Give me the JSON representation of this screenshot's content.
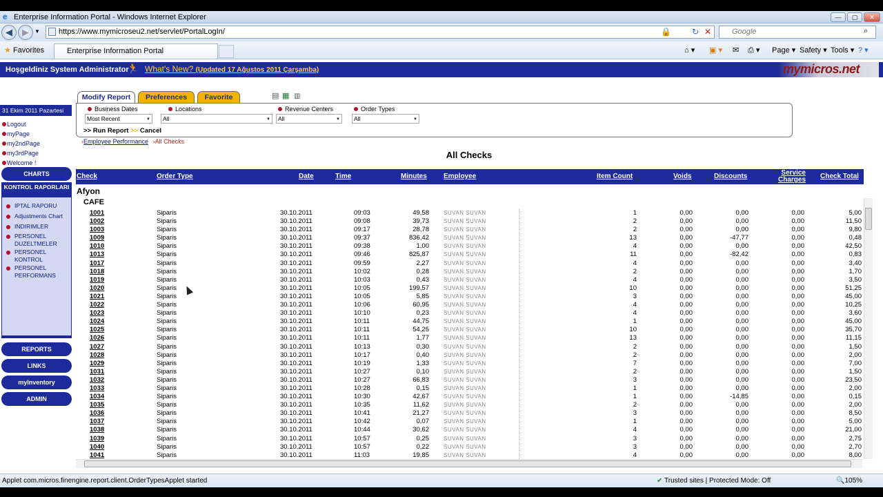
{
  "window": {
    "title": "Enterprise Information Portal - Windows Internet Explorer",
    "url": "https://www.mymicroseu2.net/servlet/PortalLogIn/",
    "search_placeholder": "Google",
    "favorites_label": "Favorites",
    "tab_title": "Enterprise Information Portal",
    "commands": {
      "page": "Page",
      "safety": "Safety",
      "tools": "Tools"
    }
  },
  "banner": {
    "welcome": "Hoşgeldiniz System Administrator",
    "whats_new": "What's New?",
    "whats_new_date": "(Updated 17 Ağustos 2011 Çarşamba)",
    "logo": "mymicros.net"
  },
  "sidebar": {
    "date": "31 Ekim 2011 Pazartesi",
    "links": [
      "Logout",
      "myPage",
      "my2ndPage",
      "my3rdPage",
      "Welcome !"
    ],
    "charts": "CHARTS",
    "kontrol_title": "KONTROL RAPORLARI",
    "kontrol_links": [
      "IPTAL RAPORU",
      "Adjustments Chart",
      "INDIRIMLER",
      "PERSONEL DUZELTMELER",
      "PERSONEL KONTROL",
      "PERSONEL PERFORMANS"
    ],
    "reports": "REPORTS",
    "links_btn": "LINKS",
    "myinventory": "myInventory",
    "admin": "ADMIN"
  },
  "tabs": {
    "modify": "Modify Report",
    "preferences": "Preferences",
    "favorite": "Favorite"
  },
  "filters": {
    "business_dates_label": "Business Dates",
    "business_dates_value": "Most Recent",
    "locations_label": "Locations",
    "locations_value": "All",
    "revenue_centers_label": "Revenue Centers",
    "revenue_centers_value": "All",
    "order_types_label": "Order Types",
    "order_types_value": "All",
    "run": ">> Run Report",
    "cancel": "Cancel"
  },
  "breadcrumbs": {
    "first": "Employee Performance",
    "second": "All Checks"
  },
  "report": {
    "title": "All Checks",
    "columns": {
      "check": "Check",
      "order_type": "Order Type",
      "date": "Date",
      "time": "Time",
      "minutes": "Minutes",
      "employee": "Employee",
      "item_count": "Item Count",
      "voids": "Voids",
      "discounts": "Discounts",
      "service_charges": "Service Charges",
      "check_total": "Check Total"
    },
    "group": "Afyon",
    "subgroup": "CAFE",
    "rows": [
      [
        "1001",
        "Siparis",
        "30.10.2011",
        "09:03",
        "49,58",
        "1",
        "0,00",
        "0,00",
        "0,00",
        "5,00"
      ],
      [
        "1002",
        "Siparis",
        "30.10.2011",
        "09:08",
        "39,73",
        "2",
        "0,00",
        "0,00",
        "0,00",
        "11,50"
      ],
      [
        "1003",
        "Siparis",
        "30.10.2011",
        "09:17",
        "28,78",
        "2",
        "0,00",
        "0,00",
        "0,00",
        "9,80"
      ],
      [
        "1009",
        "Siparis",
        "30.10.2011",
        "09:37",
        "836,42",
        "13",
        "0,00",
        "-47,77",
        "0,00",
        "0,48"
      ],
      [
        "1010",
        "Siparis",
        "30.10.2011",
        "09:38",
        "1,00",
        "4",
        "0,00",
        "0,00",
        "0,00",
        "42,50"
      ],
      [
        "1013",
        "Siparis",
        "30.10.2011",
        "09:46",
        "825,87",
        "11",
        "0,00",
        "-82,42",
        "0,00",
        "0,83"
      ],
      [
        "1017",
        "Siparis",
        "30.10.2011",
        "09:59",
        "2,27",
        "4",
        "0,00",
        "0,00",
        "0,00",
        "3,40"
      ],
      [
        "1018",
        "Siparis",
        "30.10.2011",
        "10:02",
        "0,28",
        "2",
        "0,00",
        "0,00",
        "0,00",
        "1,70"
      ],
      [
        "1019",
        "Siparis",
        "30.10.2011",
        "10:03",
        "0,43",
        "4",
        "0,00",
        "0,00",
        "0,00",
        "3,50"
      ],
      [
        "1020",
        "Siparis",
        "30.10.2011",
        "10:05",
        "199,57",
        "10",
        "0,00",
        "0,00",
        "0,00",
        "51,25"
      ],
      [
        "1021",
        "Siparis",
        "30.10.2011",
        "10:05",
        "5,85",
        "3",
        "0,00",
        "0,00",
        "0,00",
        "45,00"
      ],
      [
        "1022",
        "Siparis",
        "30.10.2011",
        "10:06",
        "60,95",
        "4",
        "0,00",
        "0,00",
        "0,00",
        "10,25"
      ],
      [
        "1023",
        "Siparis",
        "30.10.2011",
        "10:10",
        "0,23",
        "4",
        "0,00",
        "0,00",
        "0,00",
        "3,60"
      ],
      [
        "1024",
        "Siparis",
        "30.10.2011",
        "10:11",
        "44,75",
        "1",
        "0,00",
        "0,00",
        "0,00",
        "45,00"
      ],
      [
        "1025",
        "Siparis",
        "30.10.2011",
        "10:11",
        "54,25",
        "10",
        "0,00",
        "0,00",
        "0,00",
        "35,70"
      ],
      [
        "1026",
        "Siparis",
        "30.10.2011",
        "10:11",
        "1,77",
        "13",
        "0,00",
        "0,00",
        "0,00",
        "11,15"
      ],
      [
        "1027",
        "Siparis",
        "30.10.2011",
        "10:13",
        "0,30",
        "2",
        "0,00",
        "0,00",
        "0,00",
        "1,50"
      ],
      [
        "1028",
        "Siparis",
        "30.10.2011",
        "10:17",
        "0,40",
        "2",
        "0,00",
        "0,00",
        "0,00",
        "2,00"
      ],
      [
        "1029",
        "Siparis",
        "30.10.2011",
        "10:19",
        "1,33",
        "7",
        "0,00",
        "0,00",
        "0,00",
        "7,00"
      ],
      [
        "1031",
        "Siparis",
        "30.10.2011",
        "10:27",
        "0,10",
        "2",
        "0,00",
        "0,00",
        "0,00",
        "1,50"
      ],
      [
        "1032",
        "Siparis",
        "30.10.2011",
        "10:27",
        "66,83",
        "3",
        "0,00",
        "0,00",
        "0,00",
        "23,50"
      ],
      [
        "1033",
        "Siparis",
        "30.10.2011",
        "10:28",
        "0,15",
        "1",
        "0,00",
        "0,00",
        "0,00",
        "2,00"
      ],
      [
        "1034",
        "Siparis",
        "30.10.2011",
        "10:30",
        "42,67",
        "1",
        "0,00",
        "-14,85",
        "0,00",
        "0,15"
      ],
      [
        "1035",
        "Siparis",
        "30.10.2011",
        "10:35",
        "11,62",
        "2",
        "0,00",
        "0,00",
        "0,00",
        "2,00"
      ],
      [
        "1036",
        "Siparis",
        "30.10.2011",
        "10:41",
        "21,27",
        "3",
        "0,00",
        "0,00",
        "0,00",
        "8,50"
      ],
      [
        "1037",
        "Siparis",
        "30.10.2011",
        "10:42",
        "0,07",
        "1",
        "0,00",
        "0,00",
        "0,00",
        "5,00"
      ],
      [
        "1038",
        "Siparis",
        "30.10.2011",
        "10:44",
        "30,62",
        "4",
        "0,00",
        "0,00",
        "0,00",
        "21,00"
      ],
      [
        "1039",
        "Siparis",
        "30.10.2011",
        "10:57",
        "0,25",
        "3",
        "0,00",
        "0,00",
        "0,00",
        "2,75"
      ],
      [
        "1040",
        "Siparis",
        "30.10.2011",
        "10:57",
        "0,22",
        "3",
        "0,00",
        "0,00",
        "0,00",
        "2,70"
      ],
      [
        "1041",
        "Siparis",
        "30.10.2011",
        "11:03",
        "19,85",
        "4",
        "0,00",
        "0,00",
        "0,00",
        "8,00"
      ]
    ],
    "employee_masked": "SUVAN SUVAN"
  },
  "status": {
    "left": "Applet com.micros.finengine.report.client.OrderTypesApplet started",
    "zone": "Trusted sites | Protected Mode: Off",
    "zoom": "105%"
  }
}
